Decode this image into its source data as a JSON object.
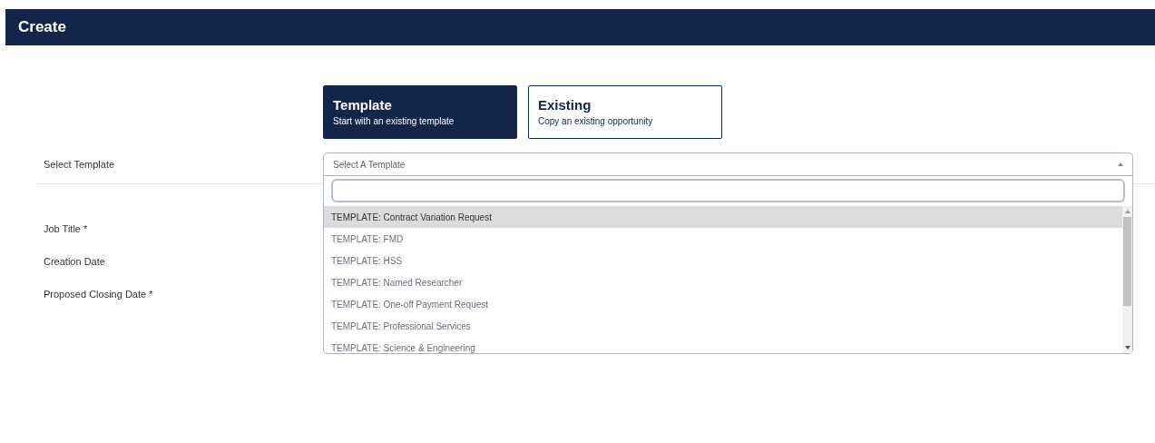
{
  "header": {
    "title": "Create"
  },
  "tabs": [
    {
      "title": "Template",
      "subtitle": "Start with an existing template",
      "selected": true
    },
    {
      "title": "Existing",
      "subtitle": "Copy an existing opportunity",
      "selected": false
    }
  ],
  "select_template": {
    "label": "Select Template",
    "placeholder": "Select A Template",
    "expanded": true,
    "options": [
      {
        "label": "TEMPLATE: Contract Variation Request",
        "selected": true
      },
      {
        "label": "TEMPLATE: FMD",
        "selected": false
      },
      {
        "label": "TEMPLATE: HSS",
        "selected": false
      },
      {
        "label": "TEMPLATE: Named Researcher",
        "selected": false
      },
      {
        "label": "TEMPLATE: One-off Payment Request",
        "selected": false
      },
      {
        "label": "TEMPLATE: Professional Services",
        "selected": false
      },
      {
        "label": "TEMPLATE: Science & Engineering",
        "selected": false
      }
    ]
  },
  "fields": [
    {
      "label": "Job Title *"
    },
    {
      "label": "Creation Date"
    },
    {
      "label": "Proposed Closing Date *"
    }
  ]
}
